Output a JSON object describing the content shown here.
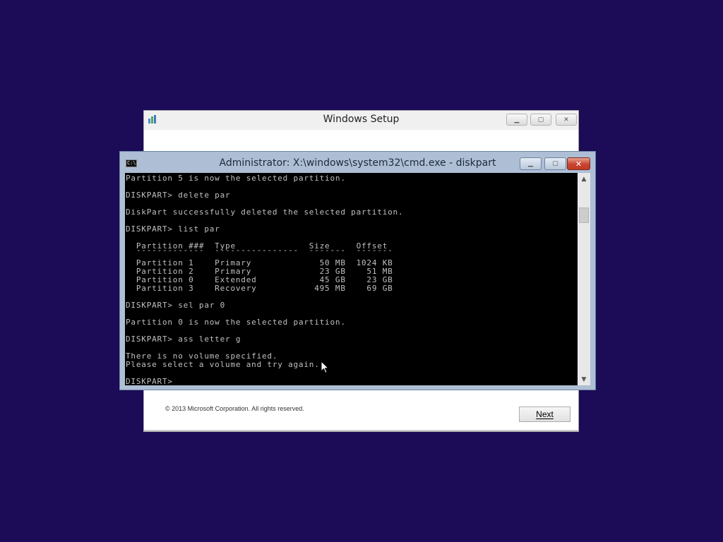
{
  "setup_window": {
    "title": "Windows Setup",
    "copyright": "© 2013 Microsoft Corporation. All rights reserved.",
    "next_button": "Next",
    "icon": "setup-app-icon"
  },
  "cmd_window": {
    "title": "Administrator: X:\\windows\\system32\\cmd.exe - diskpart",
    "icon_label": "C:\\.",
    "console_lines": [
      "Partition 5 is now the selected partition.",
      "",
      "DISKPART> delete par",
      "",
      "DiskPart successfully deleted the selected partition.",
      "",
      "DISKPART> list par",
      "",
      "  Partition ###  Type              Size     Offset",
      "  -------------  ----------------  -------  -------",
      "  Partition 1    Primary             50 MB  1024 KB",
      "  Partition 2    Primary             23 GB    51 MB",
      "  Partition 0    Extended            45 GB    23 GB",
      "  Partition 3    Recovery           495 MB    69 GB",
      "",
      "DISKPART> sel par 0",
      "",
      "Partition 0 is now the selected partition.",
      "",
      "DISKPART> ass letter g",
      "",
      "There is no volume specified.",
      "Please select a volume and try again.",
      "",
      "DISKPART> "
    ]
  },
  "colors": {
    "desktop_background": "#1c0b56",
    "console_background": "#000000",
    "console_text": "#c0c0c0",
    "cmd_frame": "#aebfd5",
    "close_button": "#c9442e"
  }
}
